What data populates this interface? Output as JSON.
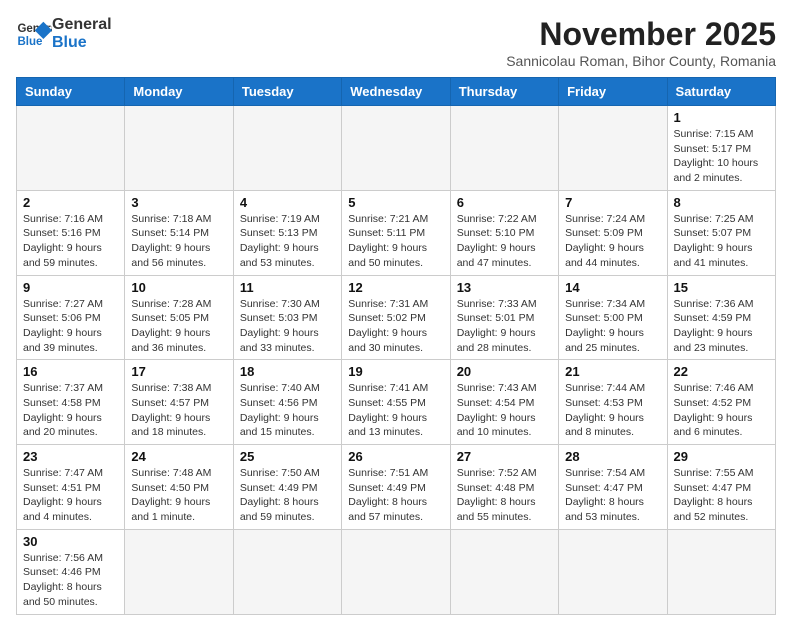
{
  "header": {
    "logo_text_general": "General",
    "logo_text_blue": "Blue",
    "month_title": "November 2025",
    "subtitle": "Sannicolau Roman, Bihor County, Romania"
  },
  "days_of_week": [
    "Sunday",
    "Monday",
    "Tuesday",
    "Wednesday",
    "Thursday",
    "Friday",
    "Saturday"
  ],
  "weeks": [
    [
      {
        "day": "",
        "info": ""
      },
      {
        "day": "",
        "info": ""
      },
      {
        "day": "",
        "info": ""
      },
      {
        "day": "",
        "info": ""
      },
      {
        "day": "",
        "info": ""
      },
      {
        "day": "",
        "info": ""
      },
      {
        "day": "1",
        "info": "Sunrise: 7:15 AM\nSunset: 5:17 PM\nDaylight: 10 hours\nand 2 minutes."
      }
    ],
    [
      {
        "day": "2",
        "info": "Sunrise: 7:16 AM\nSunset: 5:16 PM\nDaylight: 9 hours\nand 59 minutes."
      },
      {
        "day": "3",
        "info": "Sunrise: 7:18 AM\nSunset: 5:14 PM\nDaylight: 9 hours\nand 56 minutes."
      },
      {
        "day": "4",
        "info": "Sunrise: 7:19 AM\nSunset: 5:13 PM\nDaylight: 9 hours\nand 53 minutes."
      },
      {
        "day": "5",
        "info": "Sunrise: 7:21 AM\nSunset: 5:11 PM\nDaylight: 9 hours\nand 50 minutes."
      },
      {
        "day": "6",
        "info": "Sunrise: 7:22 AM\nSunset: 5:10 PM\nDaylight: 9 hours\nand 47 minutes."
      },
      {
        "day": "7",
        "info": "Sunrise: 7:24 AM\nSunset: 5:09 PM\nDaylight: 9 hours\nand 44 minutes."
      },
      {
        "day": "8",
        "info": "Sunrise: 7:25 AM\nSunset: 5:07 PM\nDaylight: 9 hours\nand 41 minutes."
      }
    ],
    [
      {
        "day": "9",
        "info": "Sunrise: 7:27 AM\nSunset: 5:06 PM\nDaylight: 9 hours\nand 39 minutes."
      },
      {
        "day": "10",
        "info": "Sunrise: 7:28 AM\nSunset: 5:05 PM\nDaylight: 9 hours\nand 36 minutes."
      },
      {
        "day": "11",
        "info": "Sunrise: 7:30 AM\nSunset: 5:03 PM\nDaylight: 9 hours\nand 33 minutes."
      },
      {
        "day": "12",
        "info": "Sunrise: 7:31 AM\nSunset: 5:02 PM\nDaylight: 9 hours\nand 30 minutes."
      },
      {
        "day": "13",
        "info": "Sunrise: 7:33 AM\nSunset: 5:01 PM\nDaylight: 9 hours\nand 28 minutes."
      },
      {
        "day": "14",
        "info": "Sunrise: 7:34 AM\nSunset: 5:00 PM\nDaylight: 9 hours\nand 25 minutes."
      },
      {
        "day": "15",
        "info": "Sunrise: 7:36 AM\nSunset: 4:59 PM\nDaylight: 9 hours\nand 23 minutes."
      }
    ],
    [
      {
        "day": "16",
        "info": "Sunrise: 7:37 AM\nSunset: 4:58 PM\nDaylight: 9 hours\nand 20 minutes."
      },
      {
        "day": "17",
        "info": "Sunrise: 7:38 AM\nSunset: 4:57 PM\nDaylight: 9 hours\nand 18 minutes."
      },
      {
        "day": "18",
        "info": "Sunrise: 7:40 AM\nSunset: 4:56 PM\nDaylight: 9 hours\nand 15 minutes."
      },
      {
        "day": "19",
        "info": "Sunrise: 7:41 AM\nSunset: 4:55 PM\nDaylight: 9 hours\nand 13 minutes."
      },
      {
        "day": "20",
        "info": "Sunrise: 7:43 AM\nSunset: 4:54 PM\nDaylight: 9 hours\nand 10 minutes."
      },
      {
        "day": "21",
        "info": "Sunrise: 7:44 AM\nSunset: 4:53 PM\nDaylight: 9 hours\nand 8 minutes."
      },
      {
        "day": "22",
        "info": "Sunrise: 7:46 AM\nSunset: 4:52 PM\nDaylight: 9 hours\nand 6 minutes."
      }
    ],
    [
      {
        "day": "23",
        "info": "Sunrise: 7:47 AM\nSunset: 4:51 PM\nDaylight: 9 hours\nand 4 minutes."
      },
      {
        "day": "24",
        "info": "Sunrise: 7:48 AM\nSunset: 4:50 PM\nDaylight: 9 hours\nand 1 minute."
      },
      {
        "day": "25",
        "info": "Sunrise: 7:50 AM\nSunset: 4:49 PM\nDaylight: 8 hours\nand 59 minutes."
      },
      {
        "day": "26",
        "info": "Sunrise: 7:51 AM\nSunset: 4:49 PM\nDaylight: 8 hours\nand 57 minutes."
      },
      {
        "day": "27",
        "info": "Sunrise: 7:52 AM\nSunset: 4:48 PM\nDaylight: 8 hours\nand 55 minutes."
      },
      {
        "day": "28",
        "info": "Sunrise: 7:54 AM\nSunset: 4:47 PM\nDaylight: 8 hours\nand 53 minutes."
      },
      {
        "day": "29",
        "info": "Sunrise: 7:55 AM\nSunset: 4:47 PM\nDaylight: 8 hours\nand 52 minutes."
      }
    ],
    [
      {
        "day": "30",
        "info": "Sunrise: 7:56 AM\nSunset: 4:46 PM\nDaylight: 8 hours\nand 50 minutes."
      },
      {
        "day": "",
        "info": ""
      },
      {
        "day": "",
        "info": ""
      },
      {
        "day": "",
        "info": ""
      },
      {
        "day": "",
        "info": ""
      },
      {
        "day": "",
        "info": ""
      },
      {
        "day": "",
        "info": ""
      }
    ]
  ]
}
